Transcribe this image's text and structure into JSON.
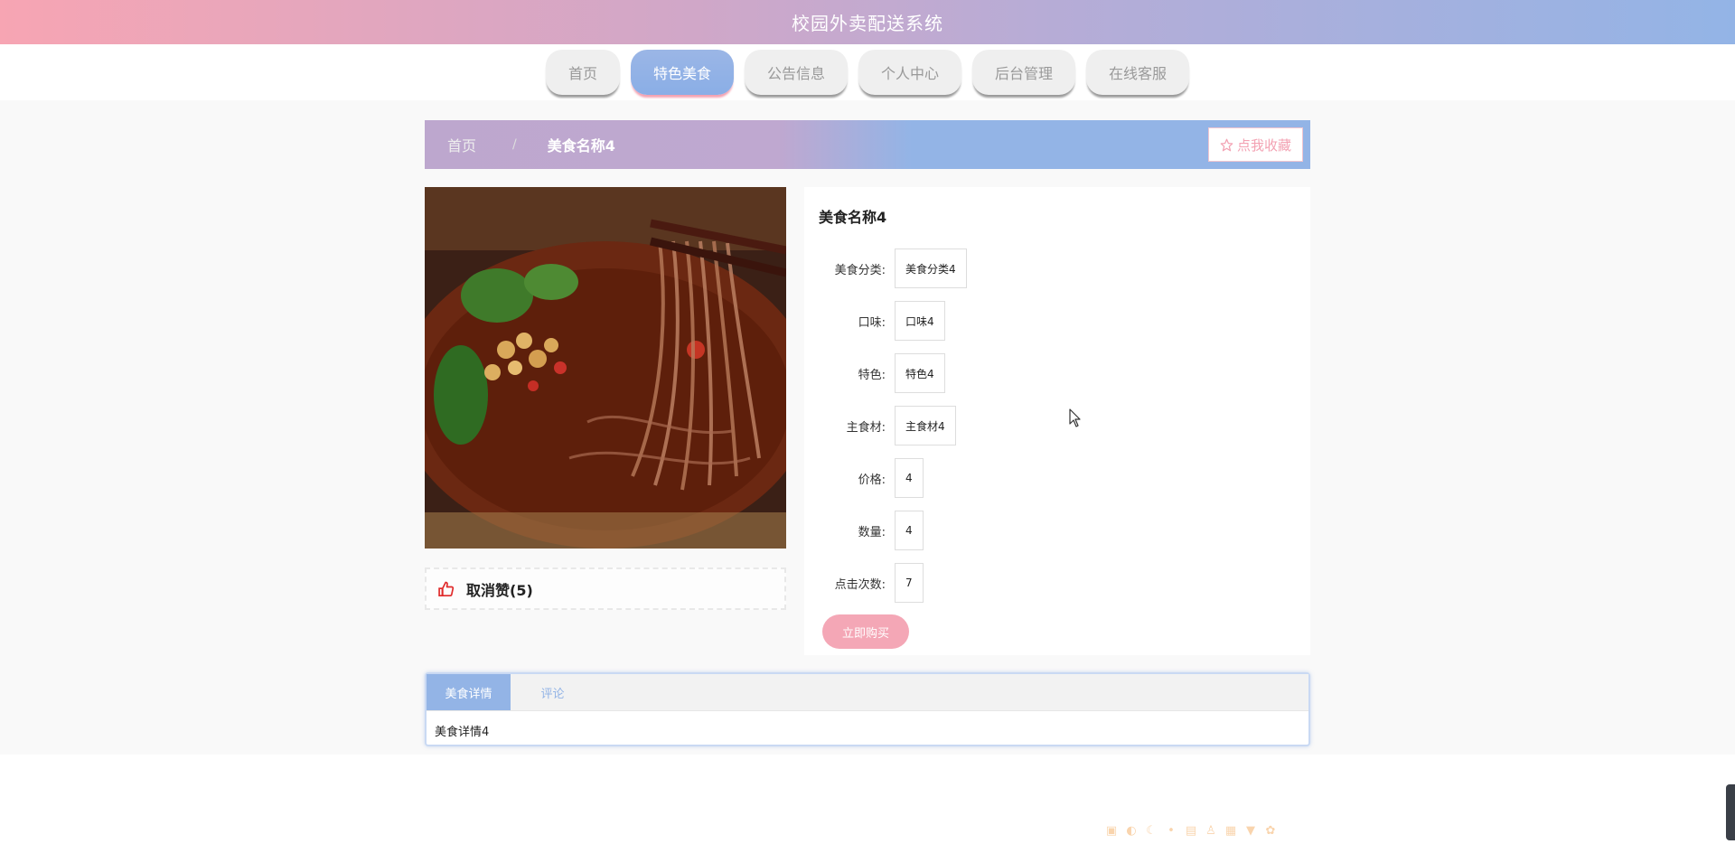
{
  "header": {
    "title": "校园外卖配送系统"
  },
  "nav": {
    "items": [
      {
        "label": "首页",
        "active": false
      },
      {
        "label": "特色美食",
        "active": true
      },
      {
        "label": "公告信息",
        "active": false
      },
      {
        "label": "个人中心",
        "active": false
      },
      {
        "label": "后台管理",
        "active": false
      },
      {
        "label": "在线客服",
        "active": false
      }
    ]
  },
  "breadcrumb": {
    "home": "首页",
    "separator": "/",
    "current": "美食名称4"
  },
  "favorite": {
    "label": "点我收藏"
  },
  "like": {
    "label": "取消赞(5)"
  },
  "detail": {
    "title": "美食名称4",
    "fields": [
      {
        "label": "美食分类:",
        "value": "美食分类4"
      },
      {
        "label": "口味:",
        "value": "口味4"
      },
      {
        "label": "特色:",
        "value": "特色4"
      },
      {
        "label": "主食材:",
        "value": "主食材4"
      },
      {
        "label": "价格:",
        "value": "4"
      },
      {
        "label": "数量:",
        "value": "4"
      },
      {
        "label": "点击次数:",
        "value": "7"
      }
    ],
    "buy_label": "立即购买"
  },
  "tabs": {
    "items": [
      {
        "label": "美食详情",
        "active": true
      },
      {
        "label": "评论",
        "active": false
      }
    ],
    "content": "美食详情4"
  },
  "colors": {
    "accent_blue": "#93b4e6",
    "accent_pink": "#f4a7b6"
  },
  "icons": {
    "favorite": "star-outline-icon",
    "like": "thumbs-up-icon"
  }
}
